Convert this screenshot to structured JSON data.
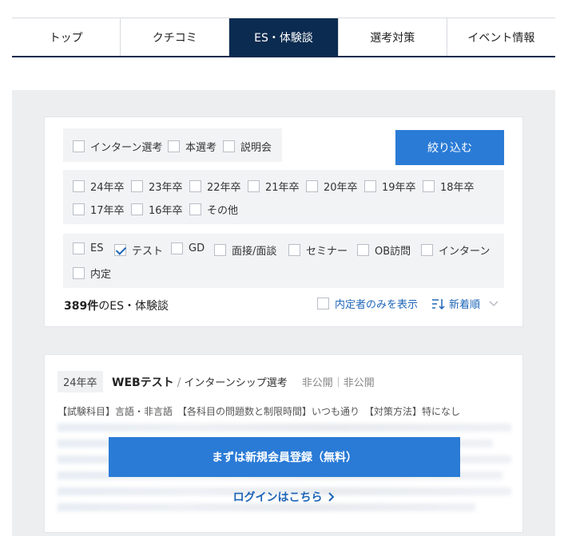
{
  "tabs": [
    {
      "label": "トップ",
      "active": false
    },
    {
      "label": "クチコミ",
      "active": false
    },
    {
      "label": "ES・体験談",
      "active": true
    },
    {
      "label": "選考対策",
      "active": false
    },
    {
      "label": "イベント情報",
      "active": false
    }
  ],
  "filter": {
    "type_options": [
      "インターン選考",
      "本選考",
      "説明会"
    ],
    "submit_label": "絞り込む",
    "year_options": [
      "24年卒",
      "23年卒",
      "22年卒",
      "21年卒",
      "20年卒",
      "19年卒",
      "18年卒",
      "17年卒",
      "16年卒",
      "その他"
    ],
    "category_options": [
      {
        "label": "ES",
        "checked": false
      },
      {
        "label": "テスト",
        "checked": true
      },
      {
        "label": "GD",
        "checked": false
      },
      {
        "label": "面接/面談",
        "checked": false
      },
      {
        "label": "セミナー",
        "checked": false
      },
      {
        "label": "OB訪問",
        "checked": false
      },
      {
        "label": "インターン",
        "checked": false
      },
      {
        "label": "内定",
        "checked": false
      }
    ],
    "count_number": "389件",
    "count_suffix": "のES・体験談",
    "only_offer_label": "内定者のみを表示",
    "sort_label": "新着順"
  },
  "review": {
    "year": "24年卒",
    "title": "WEBテスト",
    "separator": "/",
    "subtitle": "インターンシップ選考",
    "visibility": "非公開｜非公開",
    "summary": "【試験科目】言語・非言語　【各科目の問題数と制限時間】いつも通り　【対策方法】特になし",
    "register_label": "まずは新規会員登録（無料）",
    "login_label": "ログインはこちら"
  },
  "colors": {
    "navy": "#0b2b50",
    "accent": "#2a7bd6",
    "link": "#1e66b8",
    "background_gray": "#eceef0"
  },
  "icons": {
    "checkmark": "check-icon",
    "sort": "sort-icon",
    "chevron_down": "chevron-down-icon",
    "chevron_right": "chevron-right-icon"
  }
}
